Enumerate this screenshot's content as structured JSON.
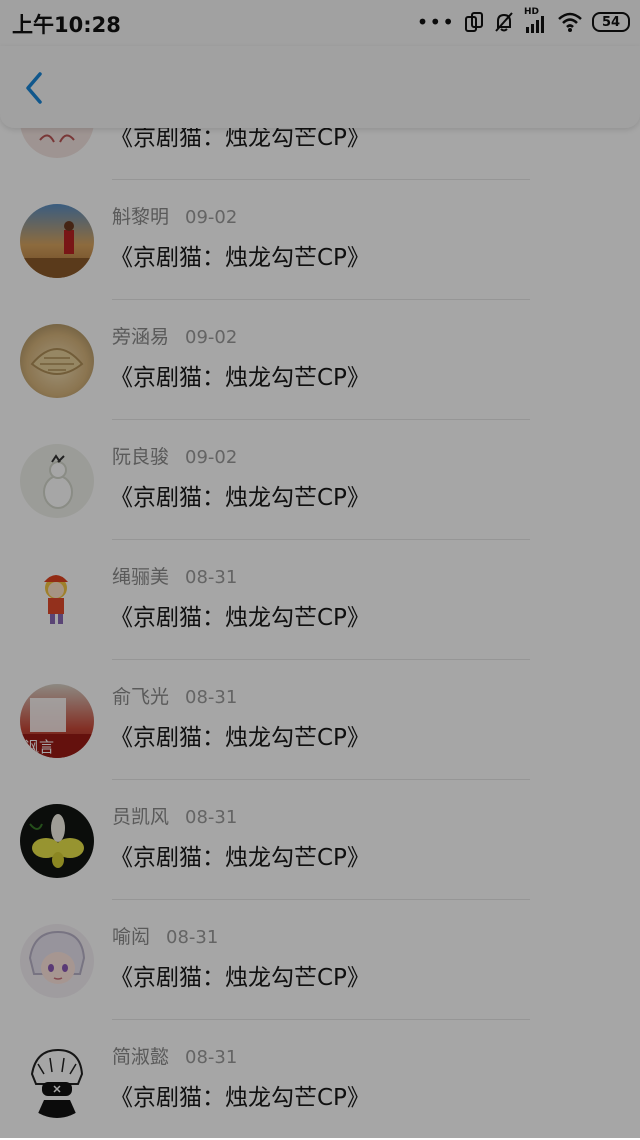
{
  "status_bar": {
    "time": "上午10:28",
    "network_label": "HD",
    "battery": "54"
  },
  "colors": {
    "accent": "#1a86d8",
    "overlay": "rgba(0,0,0,0.35)"
  },
  "header": {
    "back_icon": "chevron-left-icon"
  },
  "comments": [
    {
      "name": "",
      "date": "",
      "message": "《京剧猫：烛龙勾芒CP》"
    },
    {
      "name": "斛黎明",
      "date": "09-02",
      "message": "《京剧猫：烛龙勾芒CP》"
    },
    {
      "name": "旁涵易",
      "date": "09-02",
      "message": "《京剧猫：烛龙勾芒CP》"
    },
    {
      "name": "阮良骏",
      "date": "09-02",
      "message": "《京剧猫：烛龙勾芒CP》"
    },
    {
      "name": "绳骊美",
      "date": "08-31",
      "message": "《京剧猫：烛龙勾芒CP》"
    },
    {
      "name": "俞飞光",
      "date": "08-31",
      "message": "《京剧猫：烛龙勾芒CP》",
      "avatar_text": "讽言"
    },
    {
      "name": "员凯风",
      "date": "08-31",
      "message": "《京剧猫：烛龙勾芒CP》"
    },
    {
      "name": "喻闳",
      "date": "08-31",
      "message": "《京剧猫：烛龙勾芒CP》"
    },
    {
      "name": "简淑懿",
      "date": "08-31",
      "message": "《京剧猫：烛龙勾芒CP》"
    }
  ]
}
